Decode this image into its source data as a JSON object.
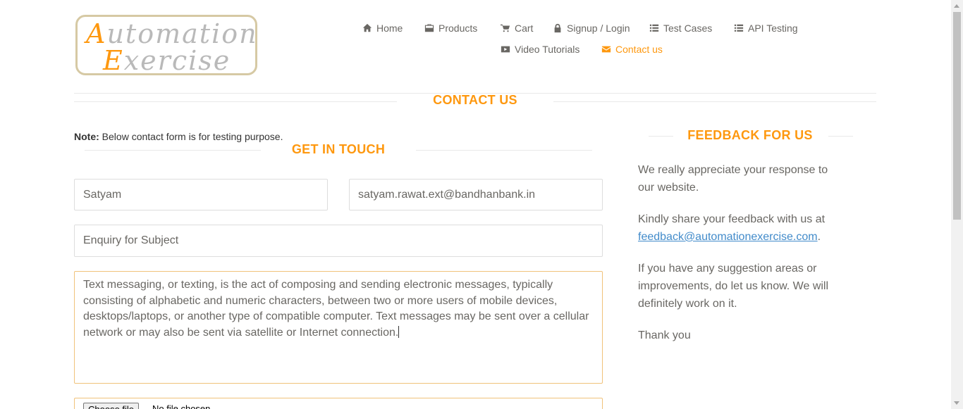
{
  "header": {
    "logo_line1_cap": "A",
    "logo_line1_rest": "utomation",
    "logo_line2_cap": "E",
    "logo_line2_rest": "xercise",
    "nav": [
      {
        "label": "Home",
        "icon": "home-icon"
      },
      {
        "label": "Products",
        "icon": "briefcase-icon"
      },
      {
        "label": "Cart",
        "icon": "cart-icon"
      },
      {
        "label": "Signup / Login",
        "icon": "lock-icon"
      },
      {
        "label": "Test Cases",
        "icon": "list-icon"
      },
      {
        "label": "API Testing",
        "icon": "list-icon"
      },
      {
        "label": "Video Tutorials",
        "icon": "youtube-icon"
      },
      {
        "label": "Contact us",
        "icon": "envelope-icon",
        "active": true
      }
    ]
  },
  "contact": {
    "title": "CONTACT US",
    "note_bold": "Note:",
    "note_text": "Below contact form is for testing purpose.",
    "get_in_touch": "GET IN TOUCH",
    "form": {
      "name_value": "Satyam",
      "email_value": "satyam.rawat.ext@bandhanbank.in",
      "subject_value": "Enquiry for Subject",
      "message_value": "Text messaging, or texting, is the act of composing and sending electronic messages, typically consisting of alphabetic and numeric characters, between two or more users of mobile devices, desktops/laptops, or another type of compatible computer. Text messages may be sent over a cellular network or may also be sent via satellite or Internet connection.",
      "file_button": "Choose file",
      "file_status": "No file chosen"
    }
  },
  "feedback": {
    "title": "FEEDBACK FOR US",
    "p1": "We really appreciate your response to our website.",
    "p2_text": "Kindly share your feedback with us at",
    "p2_link": "feedback@automationexercise.com",
    "p2_end": ".",
    "p3": "If you have any suggestion areas or improvements, do let us know. We will definitely work on it.",
    "p4": "Thank you"
  },
  "colors": {
    "accent": "#fe980f",
    "link": "#428bca",
    "text": "#696763"
  }
}
